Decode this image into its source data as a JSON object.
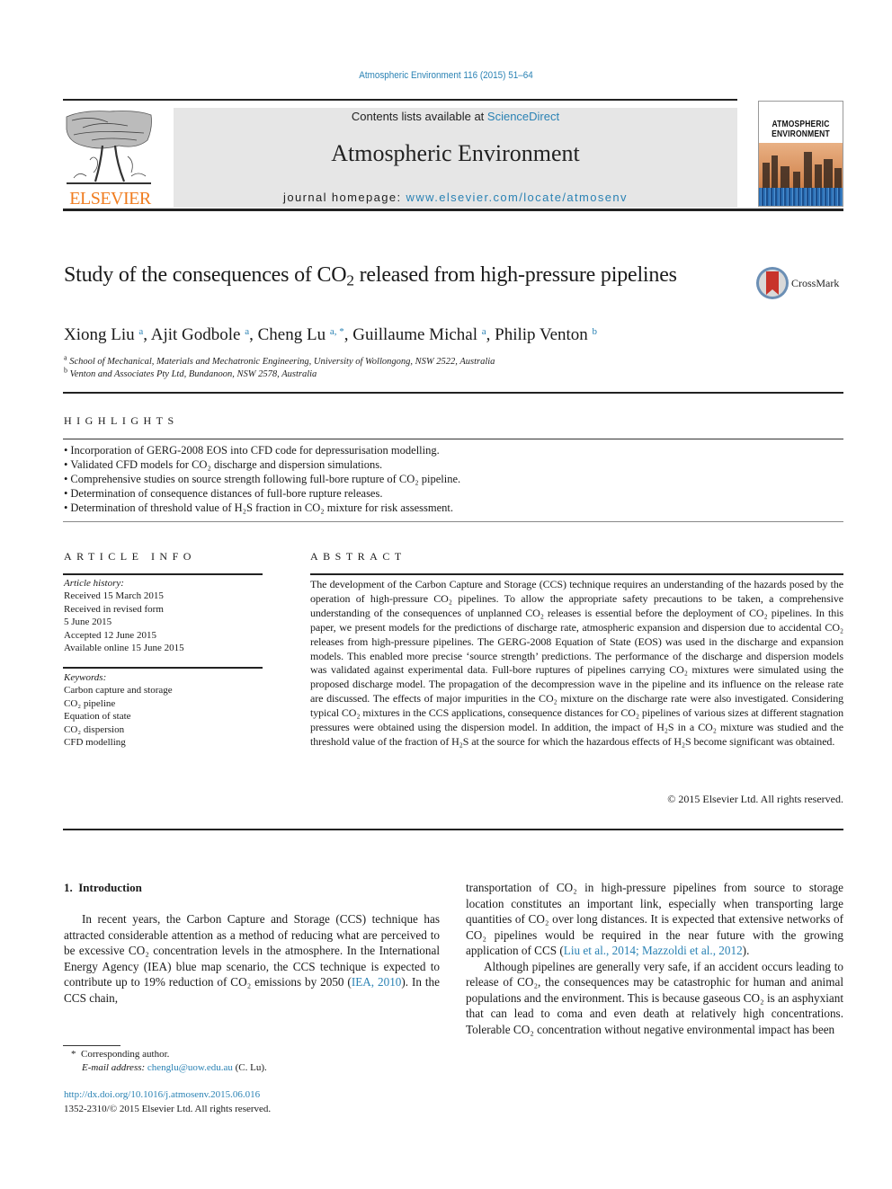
{
  "citation": "Atmospheric Environment 116 (2015) 51–64",
  "masthead": {
    "publisher": "ELSEVIER",
    "contents_prefix": "Contents lists available at ",
    "contents_link": "ScienceDirect",
    "journal_title": "Atmospheric Environment",
    "homepage_prefix": "journal homepage: ",
    "homepage_link": "www.elsevier.com/locate/atmosenv",
    "cover_title_1": "ATMOSPHERIC",
    "cover_title_2": "ENVIRONMENT"
  },
  "crossmark_label": "CrossMark",
  "article": {
    "title_part1": "Study of the consequences of CO",
    "title_sub": "2",
    "title_part2": " released from high-pressure pipelines",
    "authors": [
      {
        "name": "Xiong Liu",
        "aff": "a"
      },
      {
        "name": "Ajit Godbole",
        "aff": "a"
      },
      {
        "name": "Cheng Lu",
        "aff": "a, *"
      },
      {
        "name": "Guillaume Michal",
        "aff": "a"
      },
      {
        "name": "Philip Venton",
        "aff": "b"
      }
    ],
    "affiliations": [
      {
        "key": "a",
        "text": "School of Mechanical, Materials and Mechatronic Engineering, University of Wollongong, NSW 2522, Australia"
      },
      {
        "key": "b",
        "text": "Venton and Associates Pty Ltd, Bundanoon, NSW 2578, Australia"
      }
    ]
  },
  "highlights": {
    "heading": "HIGHLIGHTS",
    "items": [
      "Incorporation of GERG-2008 EOS into CFD code for depressurisation modelling.",
      "Validated CFD models for CO₂ discharge and dispersion simulations.",
      "Comprehensive studies on source strength following full-bore rupture of CO₂ pipeline.",
      "Determination of consequence distances of full-bore rupture releases.",
      "Determination of threshold value of H₂S fraction in CO₂ mixture for risk assessment."
    ]
  },
  "article_info": {
    "heading": "ARTICLE INFO",
    "history_label": "Article history:",
    "history": [
      "Received 15 March 2015",
      "Received in revised form",
      "5 June 2015",
      "Accepted 12 June 2015",
      "Available online 15 June 2015"
    ],
    "keywords_label": "Keywords:",
    "keywords": [
      "Carbon capture and storage",
      "CO₂ pipeline",
      "Equation of state",
      "CO₂ dispersion",
      "CFD modelling"
    ]
  },
  "abstract": {
    "heading": "ABSTRACT",
    "text": "The development of the Carbon Capture and Storage (CCS) technique requires an understanding of the hazards posed by the operation of high-pressure CO₂ pipelines. To allow the appropriate safety precautions to be taken, a comprehensive understanding of the consequences of unplanned CO₂ releases is essential before the deployment of CO₂ pipelines. In this paper, we present models for the predictions of discharge rate, atmospheric expansion and dispersion due to accidental CO₂ releases from high-pressure pipelines. The GERG-2008 Equation of State (EOS) was used in the discharge and expansion models. This enabled more precise ‘source strength’ predictions. The performance of the discharge and dispersion models was validated against experimental data. Full-bore ruptures of pipelines carrying CO₂ mixtures were simulated using the proposed discharge model. The propagation of the decompression wave in the pipeline and its influence on the release rate are discussed. The effects of major impurities in the CO₂ mixture on the discharge rate were also investigated. Considering typical CO₂ mixtures in the CCS applications, consequence distances for CO₂ pipelines of various sizes at different stagnation pressures were obtained using the dispersion model. In addition, the impact of H₂S in a CO₂ mixture was studied and the threshold value of the fraction of H₂S at the source for which the hazardous effects of H₂S become significant was obtained.",
    "copyright": "© 2015 Elsevier Ltd. All rights reserved."
  },
  "introduction": {
    "heading": "1.  Introduction",
    "col1_p1_a": "In recent years, the Carbon Capture and Storage (CCS) technique has attracted considerable attention as a method of reducing what are perceived to be excessive CO₂ concentration levels in the atmosphere. In the International Energy Agency (IEA) blue map scenario, the CCS technique is expected to contribute up to 19% reduction of CO₂ emissions by 2050 (",
    "col1_p1_link": "IEA, 2010",
    "col1_p1_b": "). In the CCS chain,",
    "col2_p1_a": "transportation of CO₂ in high-pressure pipelines from source to storage location constitutes an important link, especially when transporting large quantities of CO₂ over long distances. It is expected that extensive networks of CO₂ pipelines would be required in the near future with the growing application of CCS (",
    "col2_p1_link": "Liu et al., 2014; Mazzoldi et al., 2012",
    "col2_p1_b": ").",
    "col2_p2": "Although pipelines are generally very safe, if an accident occurs leading to release of CO₂, the consequences may be catastrophic for human and animal populations and the environment. This is because gaseous CO₂ is an asphyxiant that can lead to coma and even death at relatively high concentrations. Tolerable CO₂ concentration without negative environmental impact has been"
  },
  "footnotes": {
    "star": "*",
    "corresponding": "Corresponding author.",
    "email_label": "E-mail address:",
    "email": "chenglu@uow.edu.au",
    "email_suffix": " (C. Lu).",
    "doi": "http://dx.doi.org/10.1016/j.atmosenv.2015.06.016",
    "issn": "1352-2310/© 2015 Elsevier Ltd. All rights reserved."
  },
  "colors": {
    "link": "#2a82b4",
    "elsevier_orange": "#f07c1f",
    "masthead_gray": "#e6e6e6"
  }
}
